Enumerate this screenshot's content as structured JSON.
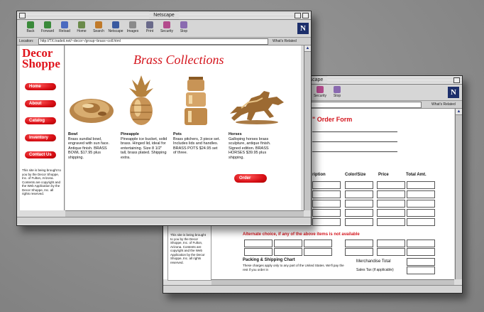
{
  "back_window": {
    "title": "Netscape",
    "toolbar": [
      {
        "label": "Security",
        "color": "#b34a8c"
      },
      {
        "label": "Stop",
        "color": "#8a6ab0"
      }
    ],
    "location": {
      "field": "",
      "related": "What's Related"
    },
    "form_title": "\" Order Form",
    "columns": [
      "ription",
      "Color/Size",
      "Price",
      "Total Amt."
    ],
    "alternate": "Alternate choice, if any of the above items is not available",
    "shipping_title": "Packing & Shipping Chart",
    "shipping_note": "These charges apply only to any part of the United States. We'll pay the rest if you order in",
    "merch_total": "Merchandise Total",
    "sales_tax": "Sales Tax (if applicable)",
    "sidebar_text": "This site is being brought to you by the Decor Shoppe, Inc. of Fulton, Arizona. Contents are copyright and the Web Application by the Decor Shoppe, Inc. all rights reserved."
  },
  "front_window": {
    "title": "Netscape",
    "toolbar": [
      {
        "label": "Back",
        "color": "#3a8a3a"
      },
      {
        "label": "Forward",
        "color": "#3a8a3a"
      },
      {
        "label": "Reload",
        "color": "#4a6ac0"
      },
      {
        "label": "Home",
        "color": "#6a8a4a"
      },
      {
        "label": "Search",
        "color": "#c07a2a"
      },
      {
        "label": "Netscape",
        "color": "#3a5aa0"
      },
      {
        "label": "Images",
        "color": "#8a8a8a"
      },
      {
        "label": "Print",
        "color": "#6a6a8a"
      },
      {
        "label": "Security",
        "color": "#b34a8c"
      },
      {
        "label": "Stop",
        "color": "#8a6ab0"
      }
    ],
    "location": {
      "label": "Location:",
      "url": "http://TX.tradeit.net/~decor~/group~brass~coll.html",
      "related": "What's Related"
    },
    "logo": [
      "Decor",
      "Shoppe"
    ],
    "nav": [
      "Home",
      "About",
      "Catalog",
      "Inventory",
      "Contact Us"
    ],
    "heading": "Brass Collections",
    "products": [
      {
        "name": "Bowl",
        "text": "Brass sundial bowl, engraved with sun face. Antique finish. BRASS BOWL $17.95 plus shipping."
      },
      {
        "name": "Pineapple",
        "text": "Pineapple ice bucket, solid brass. Hinged lid, ideal for entertaining. Size 8 1/2\" tall, brass plated. Shipping extra."
      },
      {
        "name": "Pots",
        "text": "Brass pitchers, 3 piece set. Includes lids and handles. BRASS POTS $24.95 set of three."
      },
      {
        "name": "Horses",
        "text": "Galloping horses brass sculpture, antique finish. Signed edition. BRASS HORSES $39.95 plus shipping."
      }
    ],
    "order_button": "Order",
    "sidebar_text": "This site is being brought to you by the Decor Shoppe, Inc. of Fulton, Arizona. Contents are copyright and the Web Application by the Decor Shoppe, Inc. all rights reserved."
  },
  "colors": {
    "accent": "#d4141c",
    "background": "#8c8c8c"
  }
}
